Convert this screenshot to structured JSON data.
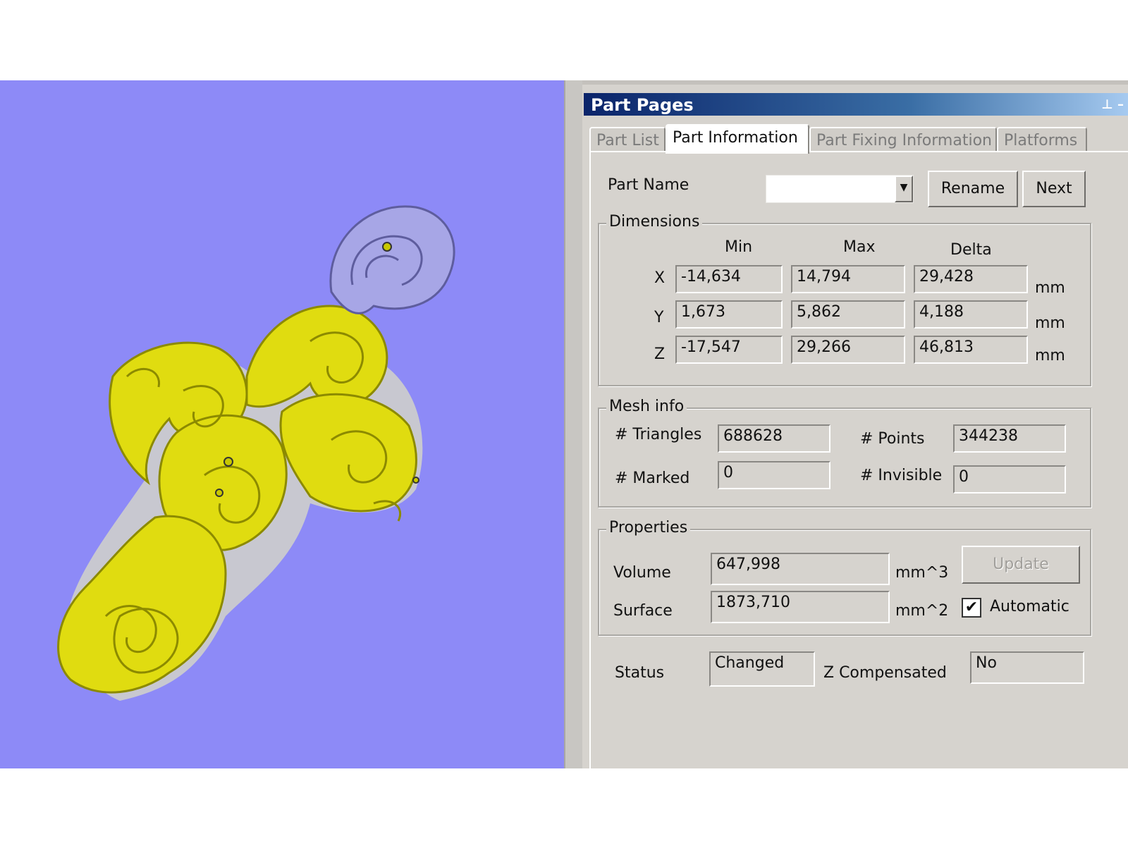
{
  "viewport": {
    "background": "#8d8af7",
    "model_color": "#e0dc10",
    "bail_color": "#a7a6e6"
  },
  "panel": {
    "title": "Part Pages",
    "tabs": [
      "Part List",
      "Part Information",
      "Part Fixing Information",
      "Platforms"
    ],
    "active_tab": "Part Information"
  },
  "part": {
    "name_label": "Part Name",
    "name_value": "",
    "rename_label": "Rename",
    "next_label": "Next"
  },
  "dimensions": {
    "title": "Dimensions",
    "col_min": "Min",
    "col_max": "Max",
    "col_delta": "Delta",
    "rows": [
      {
        "axis": "X",
        "min": "-14,634",
        "max": "14,794",
        "delta": "29,428",
        "unit": "mm"
      },
      {
        "axis": "Y",
        "min": "1,673",
        "max": "5,862",
        "delta": "4,188",
        "unit": "mm"
      },
      {
        "axis": "Z",
        "min": "-17,547",
        "max": "29,266",
        "delta": "46,813",
        "unit": "mm"
      }
    ]
  },
  "mesh": {
    "title": "Mesh info",
    "triangles_label": "# Triangles",
    "triangles": "688628",
    "points_label": "# Points",
    "points": "344238",
    "marked_label": "# Marked",
    "marked": "0",
    "invisible_label": "# Invisible",
    "invisible": "0"
  },
  "properties": {
    "title": "Properties",
    "volume_label": "Volume",
    "volume": "647,998",
    "volume_unit": "mm^3",
    "surface_label": "Surface",
    "surface": "1873,710",
    "surface_unit": "mm^2",
    "update_label": "Update",
    "automatic_label": "Automatic",
    "automatic_checked": "✔"
  },
  "status": {
    "status_label": "Status",
    "status_value": "Changed",
    "zcomp_label": "Z Compensated",
    "zcomp_value": "No"
  }
}
